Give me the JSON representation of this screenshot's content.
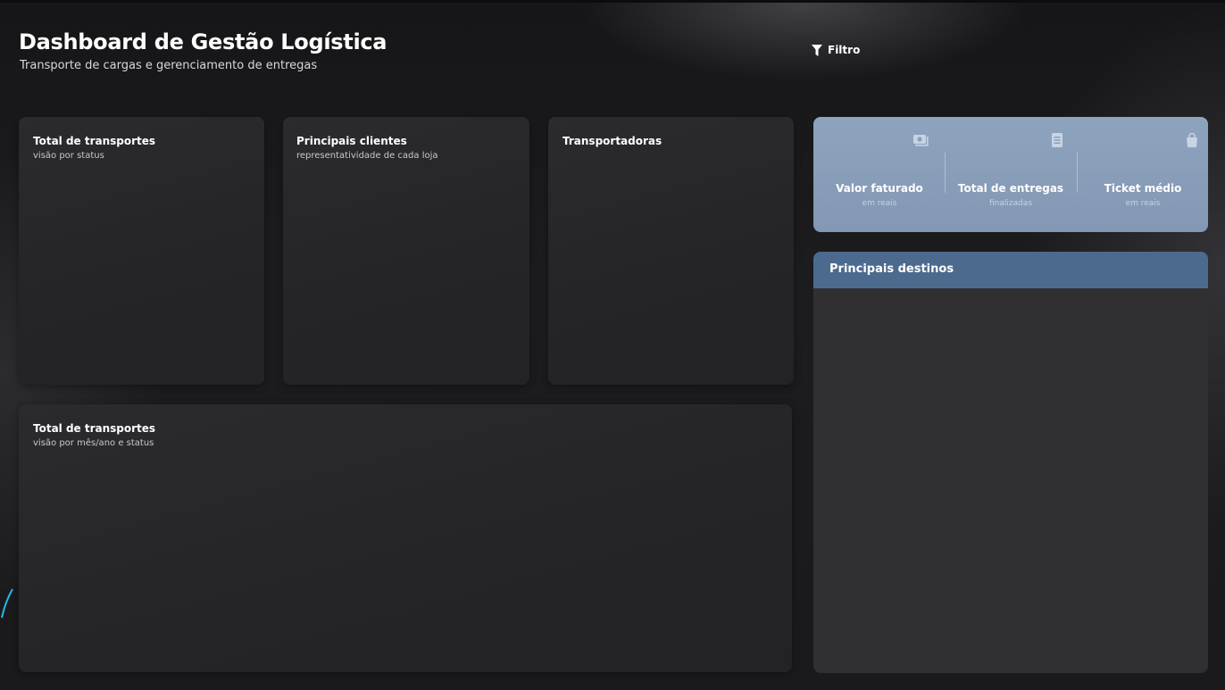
{
  "header": {
    "title": "Dashboard de Gestão Logística",
    "subtitle": "Transporte de cargas e gerenciamento de entregas",
    "filter_label": "Filtro",
    "filter_icon": "filter-icon"
  },
  "cards": {
    "status": {
      "title": "Total de transportes",
      "subtitle": "visão por status"
    },
    "clients": {
      "title": "Principais clientes",
      "subtitle": "representatividade de cada loja"
    },
    "carriers": {
      "title": "Transportadoras"
    },
    "monthly": {
      "title": "Total de transportes",
      "subtitle": "visão por mês/ano e status"
    }
  },
  "kpis": [
    {
      "label": "Valor faturado",
      "sub": "em reais",
      "icon": "money-icon"
    },
    {
      "label": "Total de entregas",
      "sub": "finalizadas",
      "icon": "document-icon"
    },
    {
      "label": "Ticket médio",
      "sub": "em reais",
      "icon": "shopping-bag-icon"
    }
  ],
  "destinations": {
    "title": "Principais destinos"
  },
  "colors": {
    "background": "#1a1a1c",
    "card": "#28282b",
    "kpi_panel": "#8a9eb9",
    "destinations_header": "#4c6a8e",
    "accent": "#29b6e8"
  }
}
